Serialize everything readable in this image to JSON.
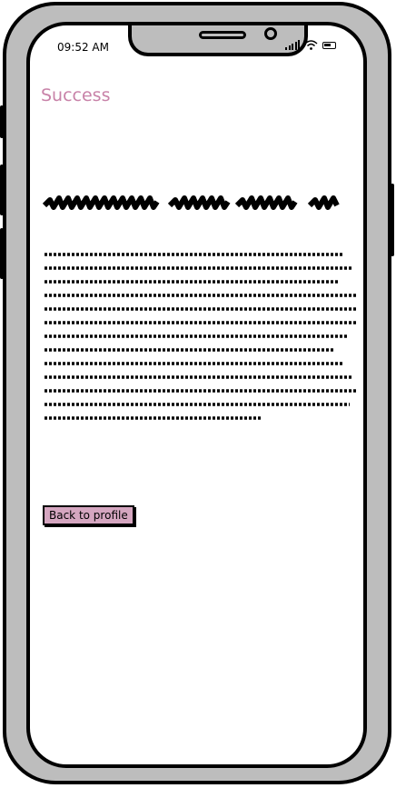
{
  "status_bar": {
    "time": "09:52 AM"
  },
  "header": {
    "title": "Success"
  },
  "content": {
    "heading_state": "illegible scribble",
    "body_state": "illegible scribble"
  },
  "actions": {
    "back_label": "Back to profile"
  },
  "colors": {
    "accent": "#c882a8",
    "button_bg": "#d5a6c0",
    "frame": "#bdbdbd"
  }
}
